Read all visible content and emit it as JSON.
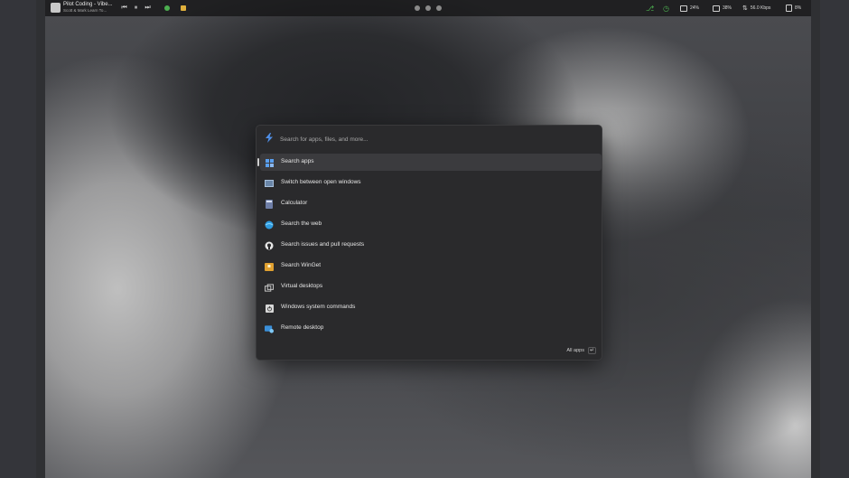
{
  "topbar": {
    "media": {
      "title": "Pilot Coding - Vibe...",
      "subtitle": "Scott & Mark Learn To..."
    },
    "stats": {
      "cpu": "24%",
      "memory": "38%",
      "network": "56.0 Kbps",
      "battery": "8%"
    }
  },
  "launcher": {
    "search": {
      "placeholder": "Search for apps, files, and more..."
    },
    "items": [
      {
        "label": "Search apps",
        "icon": "grid-apps-icon",
        "selected": true
      },
      {
        "label": "Switch between open windows",
        "icon": "window-switch-icon"
      },
      {
        "label": "Calculator",
        "icon": "calculator-icon"
      },
      {
        "label": "Search the web",
        "icon": "globe-icon"
      },
      {
        "label": "Search issues and pull requests",
        "icon": "github-icon"
      },
      {
        "label": "Search WinGet",
        "icon": "package-icon"
      },
      {
        "label": "Virtual desktops",
        "icon": "virtual-desktops-icon"
      },
      {
        "label": "Windows system commands",
        "icon": "power-icon"
      },
      {
        "label": "Remote desktop",
        "icon": "remote-desktop-icon"
      }
    ],
    "footer": {
      "all_apps_label": "All apps",
      "enter_key": "↵"
    }
  },
  "colors": {
    "accent": "#3b8fd9",
    "panel": "#2a2a2c",
    "selected_row": "#3b3b3e"
  }
}
